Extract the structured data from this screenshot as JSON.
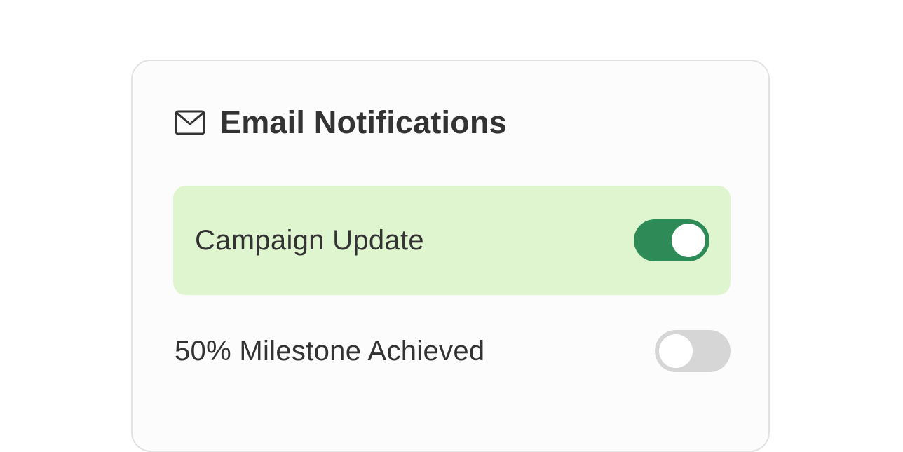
{
  "panel": {
    "title": "Email Notifications",
    "icon": "mail-icon"
  },
  "notifications": [
    {
      "label": "Campaign Update",
      "enabled": true
    },
    {
      "label": "50% Milestone Achieved",
      "enabled": false
    }
  ],
  "colors": {
    "toggle_on": "#2e8b57",
    "toggle_off": "#d6d6d6",
    "active_row_bg": "#dff5cf",
    "text": "#333333"
  }
}
